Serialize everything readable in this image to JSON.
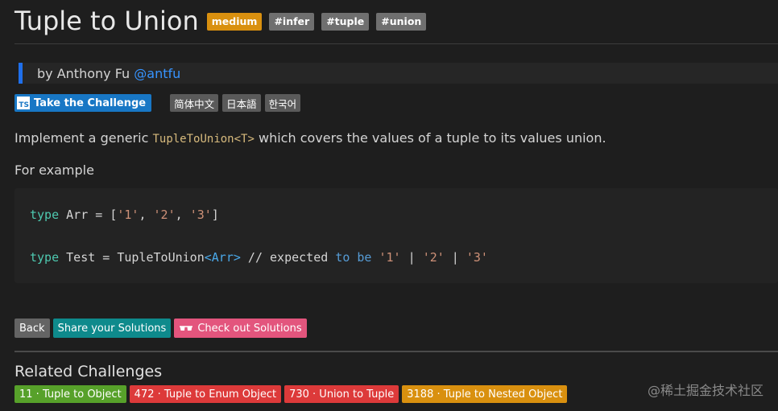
{
  "header": {
    "title": "Tuple to Union",
    "tags": [
      "medium",
      "#infer",
      "#tuple",
      "#union"
    ]
  },
  "author": {
    "prefix": "by Anthony Fu",
    "handle": "@antfu"
  },
  "challenge_button": {
    "logo": "TS",
    "label": "Take the Challenge"
  },
  "languages": [
    "简体中文",
    "日本語",
    "한국어"
  ],
  "description": {
    "before": "Implement a generic ",
    "code": "TupleToUnion<T>",
    "after": " which covers the values of a tuple to its values union."
  },
  "example_label": "For example",
  "code": {
    "line1": {
      "kw": "type",
      "mid": " Arr = [",
      "s1": "'1'",
      "c1": ", ",
      "s2": "'2'",
      "c2": ", ",
      "s3": "'3'",
      "end": "]"
    },
    "line2": {
      "kw": "type",
      "mid": " Test = TupleToUnion",
      "gen": "<Arr>",
      "cmt": " // expected ",
      "to": "to",
      "sp": " ",
      "be": "be",
      "sp2": " ",
      "s1": "'1'",
      "p1": " | ",
      "s2": "'2'",
      "p2": " | ",
      "s3": "'3'"
    }
  },
  "actions": {
    "back": "Back",
    "share": "Share your Solutions",
    "check_icon": "glasses-icon",
    "check": "Check out Solutions"
  },
  "related": {
    "title": "Related Challenges",
    "items": [
      "11 · Tuple to Object",
      "472 · Tuple to Enum Object",
      "730 · Union to Tuple",
      "3188 · Tuple to Nested Object"
    ]
  },
  "watermark": "@稀土掘金技术社区",
  "colors": {
    "background": "#1e1e1e",
    "medium": "#d9900f",
    "ts_blue": "#1877c5",
    "share": "#0e8a8c",
    "check": "#e3557d"
  }
}
